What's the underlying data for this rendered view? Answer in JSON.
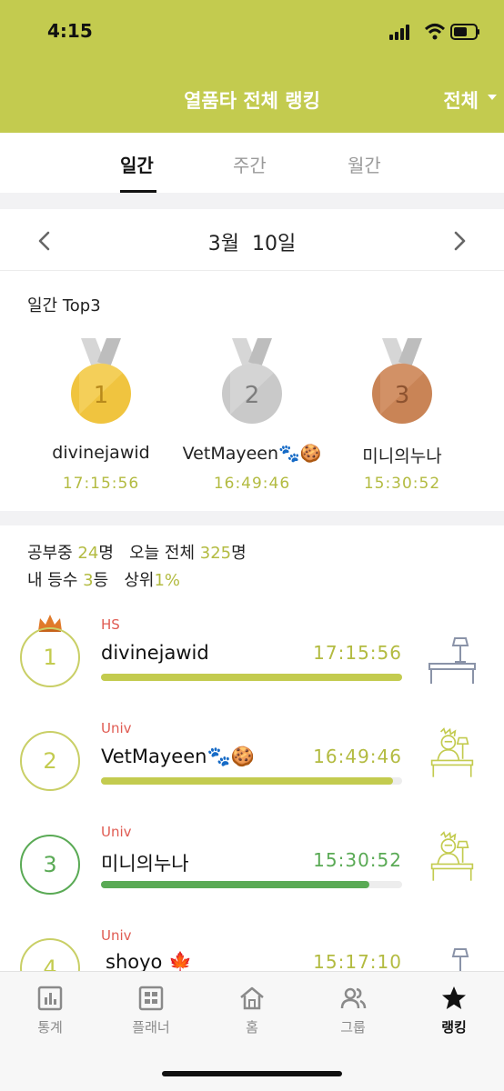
{
  "status": {
    "time": "4:15"
  },
  "header": {
    "title": "열품타 전체 랭킹",
    "filter_label": "전체",
    "bg_color": "#c3cb4f"
  },
  "tabs": [
    {
      "label": "일간",
      "active": true
    },
    {
      "label": "주간",
      "active": false
    },
    {
      "label": "월간",
      "active": false
    }
  ],
  "date": {
    "label": "3월  10일"
  },
  "top3": {
    "title": "일간 Top3",
    "medals": [
      {
        "rank": "1",
        "name": "divinejawid",
        "time": "17:15:56",
        "color": "#f0c43f"
      },
      {
        "rank": "2",
        "name": "VetMayeen🐾🍪",
        "time": "16:49:46",
        "color": "#c9c9c9"
      },
      {
        "rank": "3",
        "name": "미니의누나",
        "time": "15:30:52",
        "color": "#c98456"
      }
    ]
  },
  "stats": {
    "studying_label": "공부중",
    "studying_count": "24",
    "studying_unit": "명",
    "today_label": "오늘 전체",
    "today_count": "325",
    "today_unit": "명",
    "my_rank_label": "내 등수",
    "my_rank": "3",
    "my_rank_unit": "등",
    "top_label": "상위",
    "top_pct": "1%"
  },
  "rankings": [
    {
      "rank": "1",
      "tag": "HS",
      "name": "divinejawid",
      "time": "17:15:56",
      "progress": 1.0,
      "crown": true,
      "desk_icon": "desk-lamp-icon"
    },
    {
      "rank": "2",
      "tag": "Univ",
      "name": "VetMayeen🐾🍪",
      "time": "16:49:46",
      "progress": 0.97,
      "crown": false,
      "desk_icon": "studying-person-icon"
    },
    {
      "rank": "3",
      "tag": "Univ",
      "name": "미니의누나",
      "time": "15:30:52",
      "progress": 0.89,
      "crown": false,
      "desk_icon": "studying-person-icon"
    },
    {
      "rank": "4",
      "tag": "Univ",
      "name": "shoyo 🍁",
      "time": "15:17:10",
      "progress": 0.88,
      "crown": false,
      "desk_icon": "desk-lamp-icon"
    }
  ],
  "navbar": [
    {
      "label": "통계",
      "icon": "stats-icon"
    },
    {
      "label": "플래너",
      "icon": "planner-icon"
    },
    {
      "label": "홈",
      "icon": "home-icon"
    },
    {
      "label": "그룹",
      "icon": "group-icon"
    },
    {
      "label": "랭킹",
      "icon": "star-icon",
      "active": true
    }
  ]
}
